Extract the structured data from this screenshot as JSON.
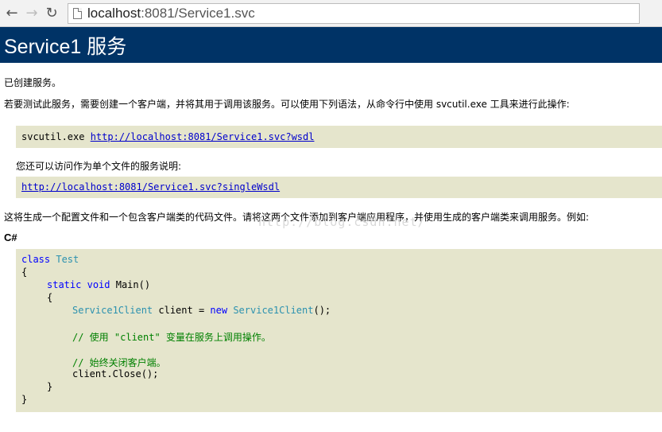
{
  "browser": {
    "url_host": "localhost",
    "url_rest": ":8081/Service1.svc"
  },
  "page": {
    "title": "Service1 服务",
    "created_text": "已创建服务。",
    "instructions": "若要测试此服务，需要创建一个客户端，并将其用于调用该服务。可以使用下列语法，从命令行中使用 svcutil.exe 工具来进行此操作:",
    "svcutil_cmd": "svcutil.exe ",
    "wsdl_link": "http://localhost:8081/Service1.svc?wsdl",
    "single_file_text": "您还可以访问作为单个文件的服务说明:",
    "single_wsdl_link": "http://localhost:8081/Service1.svc?singleWsdl",
    "generate_text": "这将生成一个配置文件和一个包含客户端类的代码文件。请将这两个文件添加到客户端应用程序，并使用生成的客户端类来调用服务。例如:",
    "lang_label": "C#",
    "watermark": "http://blog.csdn.net/"
  },
  "code": {
    "l1_kw": "class",
    "l1_type": "Test",
    "l2": "{",
    "l3_kw1": "static",
    "l3_kw2": "void",
    "l3_rest": "Main()",
    "l4": "{",
    "l5_type": "Service1Client",
    "l5_mid": " client = ",
    "l5_kw": "new",
    "l5_type2": "Service1Client",
    "l5_end": "();",
    "l6_comment": "// 使用 \"client\" 变量在服务上调用操作。",
    "l7_comment": "// 始终关闭客户端。",
    "l8": "client.Close();",
    "l9": "}",
    "l10": "}"
  }
}
